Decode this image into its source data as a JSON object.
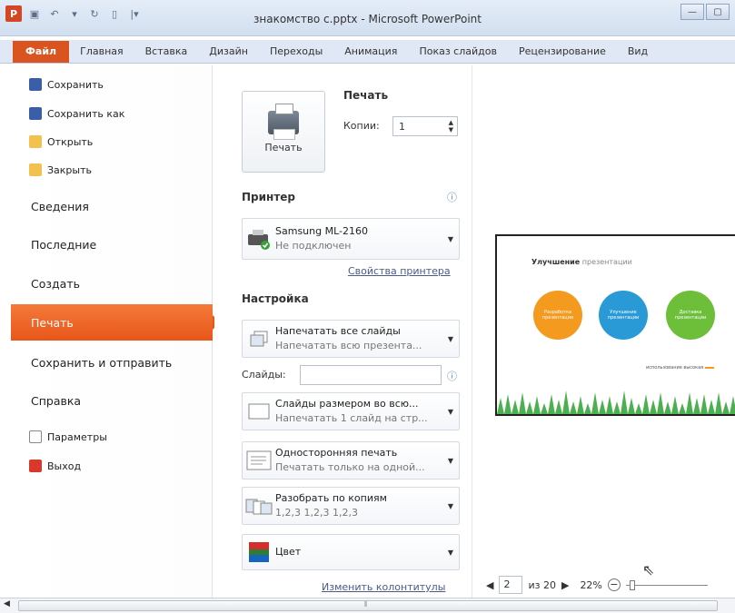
{
  "window": {
    "title": "знакомство с.pptx - Microsoft PowerPoint",
    "app_icon_letter": "P"
  },
  "tabs": [
    "Файл",
    "Главная",
    "Вставка",
    "Дизайн",
    "Переходы",
    "Анимация",
    "Показ слайдов",
    "Рецензирование",
    "Вид"
  ],
  "sidebar": {
    "items": [
      {
        "label": "Сохранить",
        "icon": "save-icon"
      },
      {
        "label": "Сохранить как",
        "icon": "save-as-icon"
      },
      {
        "label": "Открыть",
        "icon": "folder-open-icon"
      },
      {
        "label": "Закрыть",
        "icon": "folder-close-icon"
      }
    ],
    "sections": [
      "Сведения",
      "Последние",
      "Создать",
      "Печать",
      "Сохранить и отправить",
      "Справка"
    ],
    "active": "Печать",
    "bottom": [
      {
        "label": "Параметры",
        "icon": "options-icon"
      },
      {
        "label": "Выход",
        "icon": "exit-icon"
      }
    ]
  },
  "print": {
    "heading": "Печать",
    "button_label": "Печать",
    "copies_label": "Копии:",
    "copies_value": "1",
    "printer_heading": "Принтер",
    "printer_name": "Samsung ML-2160",
    "printer_status": "Не подключен",
    "printer_props_link": "Свойства принтера",
    "settings_heading": "Настройка",
    "setting1_l1": "Напечатать все слайды",
    "setting1_l2": "Напечатать всю презента...",
    "slides_label": "Слайды:",
    "slides_value": "",
    "setting2_l1": "Слайды размером во всю...",
    "setting2_l2": "Напечатать 1 слайд на стр...",
    "setting3_l1": "Односторонняя печать",
    "setting3_l2": "Печатать только на одной...",
    "setting4_l1": "Разобрать по копиям",
    "setting4_l2": "1,2,3   1,2,3   1,2,3",
    "setting5_l1": "Цвет",
    "footer_link": "Изменить колонтитулы"
  },
  "preview": {
    "slide_title_dark": "Улучшение",
    "slide_title_light": " презентации",
    "circle1": "Разработка презентации",
    "circle2": "Улучшение презентации",
    "circle3": "Доставка презентации",
    "circle_colors": [
      "#f39a1f",
      "#2a9ad6",
      "#6dbf3a"
    ],
    "legend_text": "использование высокая",
    "page_value": "2",
    "page_total": "из 20",
    "zoom": "22%"
  }
}
